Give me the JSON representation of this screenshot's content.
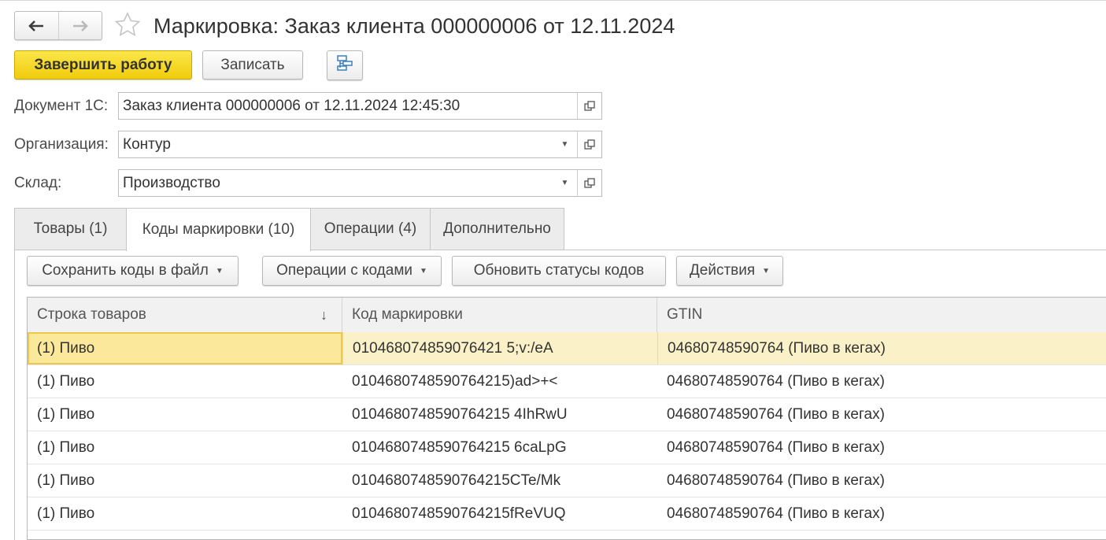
{
  "window": {
    "title": "Маркировка: Заказ клиента 000000006 от 12.11.2024"
  },
  "nav": {
    "back_glyph": "🡐",
    "forward_glyph": "🡒"
  },
  "toolbar": {
    "finish_label": "Завершить работу",
    "save_label": "Записать",
    "structure_icon": "document-structure-icon"
  },
  "form": {
    "document": {
      "label": "Документ 1С:",
      "value": "Заказ клиента 000000006 от 12.11.2024 12:45:30"
    },
    "organization": {
      "label": "Организация:",
      "value": "Контур"
    },
    "warehouse": {
      "label": "Склад:",
      "value": "Производство"
    }
  },
  "tabs": [
    {
      "label": "Товары (1)",
      "active": false
    },
    {
      "label": "Коды маркировки (10)",
      "active": true
    },
    {
      "label": "Операции (4)",
      "active": false
    },
    {
      "label": "Дополнительно",
      "active": false
    }
  ],
  "panel": {
    "buttons": {
      "save_codes": "Сохранить коды в файл",
      "code_ops": "Операции с кодами",
      "refresh_statuses": "Обновить статусы кодов",
      "actions": "Действия"
    }
  },
  "grid": {
    "columns": [
      "Строка товаров",
      "Код маркировки",
      "GTIN"
    ],
    "sort_glyph": "↓",
    "rows": [
      [
        "(1) Пиво",
        "010468074859076421 5;v:/eA",
        "04680748590764 (Пиво в кегах)"
      ],
      [
        "(1) Пиво",
        "0104680748590764215)ad>+<",
        "04680748590764 (Пиво в кегах)"
      ],
      [
        "(1) Пиво",
        "0104680748590764215 4IhRwU",
        "04680748590764 (Пиво в кегах)"
      ],
      [
        "(1) Пиво",
        "0104680748590764215 6caLpG",
        "04680748590764 (Пиво в кегах)"
      ],
      [
        "(1) Пиво",
        "0104680748590764215CTe/Mk",
        "04680748590764 (Пиво в кегах)"
      ],
      [
        "(1) Пиво",
        "0104680748590764215fReVUQ",
        "04680748590764 (Пиво в кегах)"
      ]
    ],
    "selected_row": 0
  },
  "colors": {
    "accent": "#f5d21c",
    "selected_row": "#fbf1c8",
    "selected_cell_border": "#ecc94b"
  }
}
